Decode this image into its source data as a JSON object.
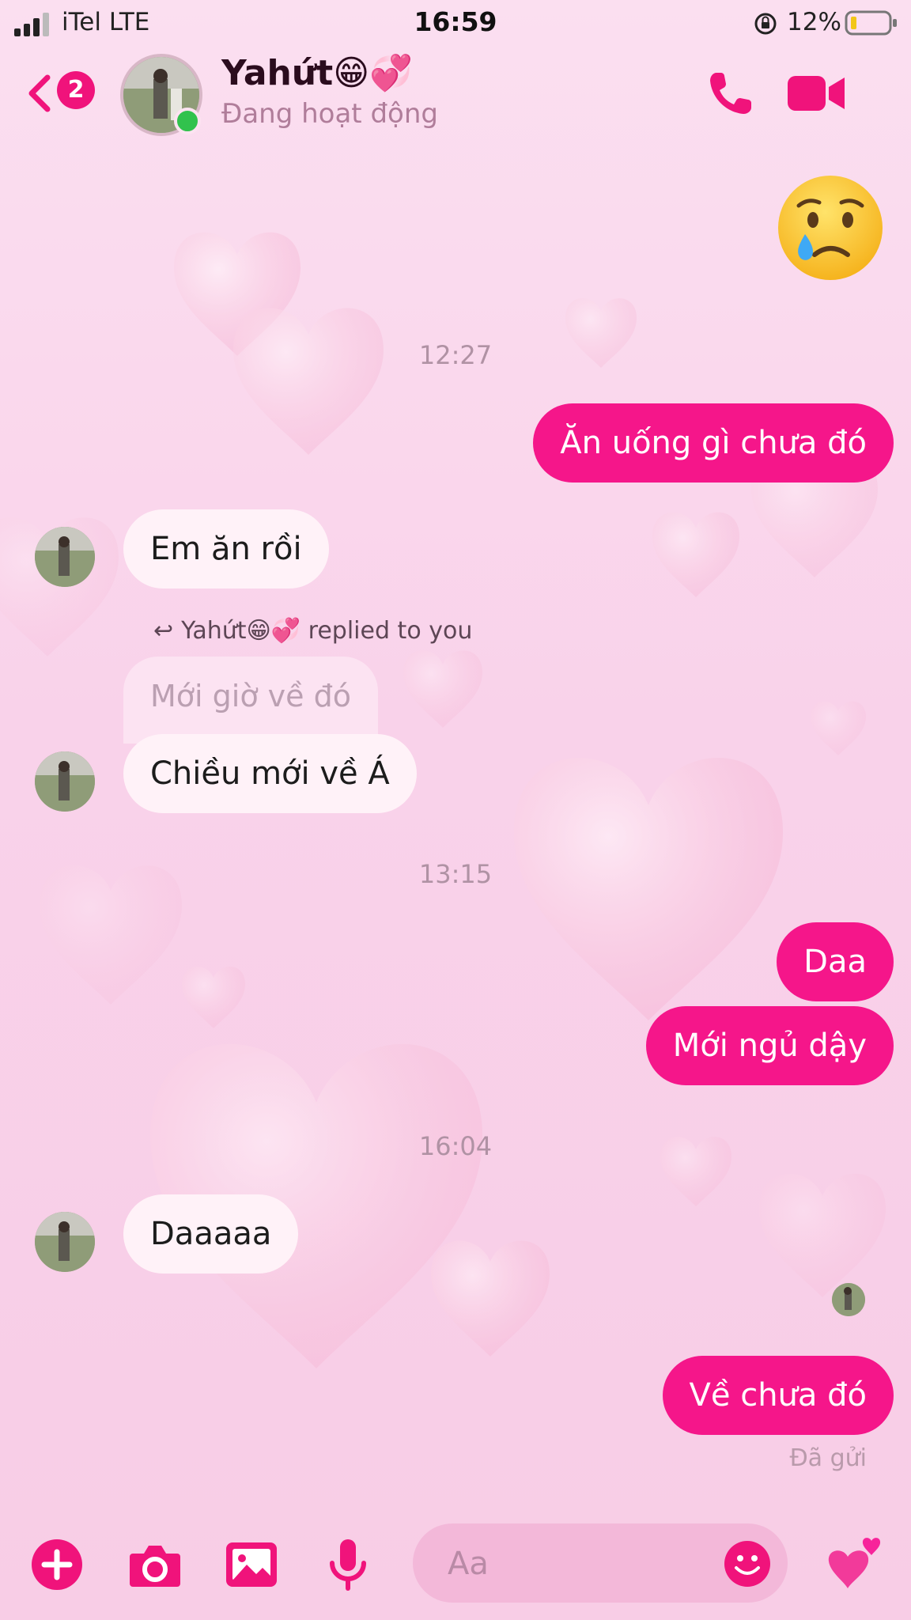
{
  "status_bar": {
    "carrier": "iTel  LTE",
    "time": "16:59",
    "battery": "12%"
  },
  "header": {
    "back_badge": "2",
    "contact_name": "Yahứt😁💞",
    "subtitle": "Đang hoạt động"
  },
  "messages": {
    "emoji_sent": "crying-face",
    "time_1": "12:27",
    "out_1": "Ăn uống gì chưa đó",
    "in_1": "Em ăn rồi",
    "reply_note": "Yahứt😁💞 replied to you",
    "quoted_text": "Mới giờ về đó",
    "in_2": "Chiều mới về Á",
    "time_2": "13:15",
    "out_2": "Daa",
    "out_3": "Mới ngủ dậy",
    "time_3": "16:04",
    "in_3": "Daaaaa",
    "out_4": "Về chưa đó",
    "sent_status": "Đã gửi"
  },
  "composer": {
    "placeholder": "Aa"
  },
  "colors": {
    "accent": "#f5168a",
    "background": "#f9d2ea",
    "incoming_bubble": "#fff2f8",
    "online": "#31c24d"
  }
}
